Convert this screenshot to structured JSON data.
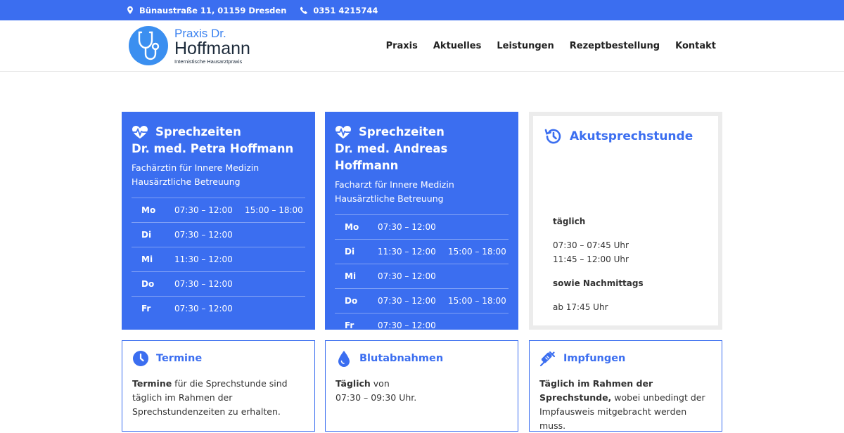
{
  "topbar": {
    "address": "Bünaustraße 11, 01159 Dresden",
    "phone": "0351 4215744",
    "address_icon": "map-marker-icon",
    "phone_icon": "phone-icon"
  },
  "logo": {
    "line1": "Praxis Dr.",
    "line2": "Hoffmann",
    "line3": "Internistische Hausarztpraxis",
    "icon": "stethoscope-icon"
  },
  "nav": {
    "items": [
      "Praxis",
      "Aktuelles",
      "Leistungen",
      "Rezeptbestellung",
      "Kontakt"
    ]
  },
  "colors": {
    "brand_blue": "#3b6ef0",
    "acute_border": "#ececec"
  },
  "card1": {
    "heading": "Sprechzeiten",
    "doctor": "Dr. med. Petra Hoffmann",
    "sub1": "Fachärztin für Innere Medizin",
    "sub2": "Hausärztliche Betreuung",
    "rows": [
      {
        "day": "Mo",
        "t1": "07:30 – 12:00",
        "t2": "15:00 – 18:00"
      },
      {
        "day": "Di",
        "t1": "07:30 – 12:00",
        "t2": ""
      },
      {
        "day": "Mi",
        "t1": "11:30 – 12:00",
        "t2": ""
      },
      {
        "day": "Do",
        "t1": "07:30 – 12:00",
        "t2": ""
      },
      {
        "day": "Fr",
        "t1": "07:30 – 12:00",
        "t2": ""
      }
    ]
  },
  "card2": {
    "heading": "Sprechzeiten",
    "doctor": "Dr. med. Andreas Hoffmann",
    "sub1": "Facharzt für Innere Medizin",
    "sub2": "Hausärztliche Betreuung",
    "rows": [
      {
        "day": "Mo",
        "t1": "07:30 – 12:00",
        "t2": ""
      },
      {
        "day": "Di",
        "t1": "11:30 – 12:00",
        "t2": "15:00 – 18:00"
      },
      {
        "day": "Mi",
        "t1": "07:30 – 12:00",
        "t2": ""
      },
      {
        "day": "Do",
        "t1": "07:30 – 12:00",
        "t2": "15:00 – 18:00"
      },
      {
        "day": "Fr",
        "t1": "07:30 – 12:00",
        "t2": ""
      }
    ]
  },
  "acute": {
    "heading": "Akutsprechstunde",
    "label1": "täglich",
    "time1": "07:30 – 07:45 Uhr",
    "time2": "11:45 – 12:00 Uhr",
    "label2": "sowie Nachmittags",
    "time3": "ab 17:45 Uhr"
  },
  "termine": {
    "heading": "Termine",
    "bold": "Termine",
    "text": " für die Sprechstunde sind täglich im Rahmen der Sprechstundenzeiten zu erhalten."
  },
  "blut": {
    "heading": "Blutabnahmen",
    "bold": "Täglich",
    "text1": " von",
    "text2": "07:30 – 09:30 Uhr."
  },
  "impf": {
    "heading": "Impfungen",
    "bold": "Täglich im Rahmen der Sprechstunde,",
    "text": " wobei unbedingt der Impfausweis mitgebracht werden muss."
  }
}
